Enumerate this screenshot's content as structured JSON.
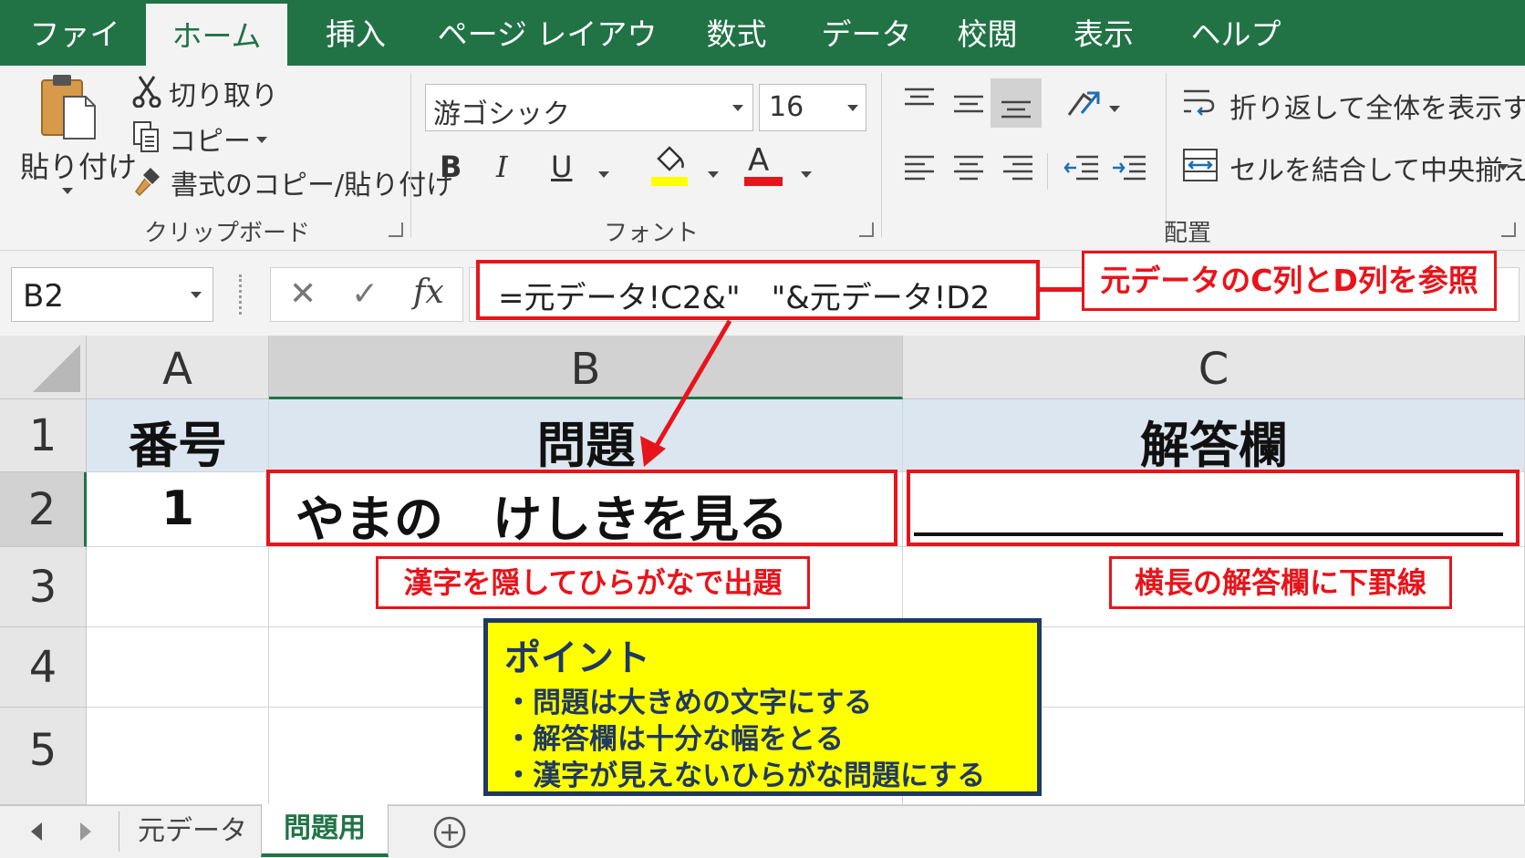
{
  "ribbon_tabs": [
    "ファイル",
    "ホーム",
    "挿入",
    "ページ レイアウト",
    "数式",
    "データ",
    "校閲",
    "表示",
    "ヘルプ"
  ],
  "active_tab": "ホーム",
  "clipboard": {
    "paste": "貼り付け",
    "cut": "切り取り",
    "copy": "コピー",
    "format_painter": "書式のコピー/貼り付け",
    "group_label": "クリップボード"
  },
  "font": {
    "name": "游ゴシック",
    "size": "16",
    "bold": "B",
    "italic": "I",
    "underline": "U",
    "font_color_glyph": "A",
    "group_label": "フォント",
    "fill_color": "#ffff00",
    "text_color": "#e8141b"
  },
  "alignment": {
    "wrap_text": "折り返して全体を表示する",
    "merge_center": "セルを結合して中央揃え",
    "group_label": "配置"
  },
  "formula_bar": {
    "name_box": "B2",
    "cancel": "✕",
    "enter": "✓",
    "fx": "fx",
    "formula": "=元データ!C2&\"　\"&元データ!D2"
  },
  "grid": {
    "columns": [
      "A",
      "B",
      "C"
    ],
    "rows": [
      "1",
      "2",
      "3",
      "4",
      "5"
    ],
    "selected_column": "B",
    "selected_row": "2",
    "cells": {
      "A1": "番号",
      "B1": "問題",
      "C1": "解答欄",
      "A2": "1",
      "B2": "やまの　けしきを見る",
      "C2": ""
    },
    "header_fill": "#dce6f1"
  },
  "annotations": {
    "formula_note": "元データのC列とD列を参照",
    "question_note": "漢字を隠してひらがなで出題",
    "answer_note": "横長の解答欄に下罫線",
    "point_title": "ポイント",
    "point_items": [
      "・問題は大きめの文字にする",
      "・解答欄は十分な幅をとる",
      "・漢字が見えないひらがな問題にする"
    ],
    "point_fill": "#ffff00",
    "point_border": "#1f3864",
    "accent": "#e8141b"
  },
  "sheets": [
    "元データ",
    "問題用"
  ],
  "active_sheet": "問題用",
  "theme_color": "#217346"
}
